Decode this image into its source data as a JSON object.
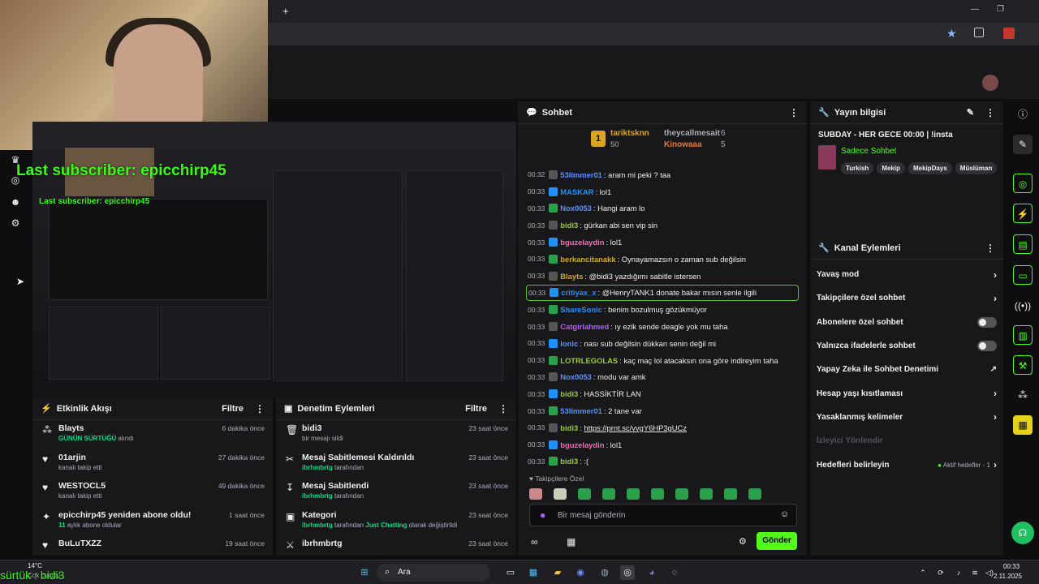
{
  "browser": {
    "new_tab": "+",
    "minimize": "—",
    "restore": "❐"
  },
  "overlay": {
    "last_subscriber": "Last subscriber: epicchirp45",
    "last_subscriber_small": "Last subscriber: epicchirp45",
    "bottom_text": "sürtük : bidi3"
  },
  "activity_feed": {
    "title": "Etkinlik Akışı",
    "filter": "Filtre",
    "items": [
      {
        "name": "Blayts",
        "detail_highlight": "GÜNÜN SÜRTÜĞÜ",
        "detail": " alındı",
        "time": "6 dakika önce",
        "icon": "points-icon"
      },
      {
        "name": "01arjin",
        "detail_highlight": "",
        "detail": "kanalı takip etti",
        "time": "27 dakika önce",
        "icon": "heart-icon"
      },
      {
        "name": "WESTOCL5",
        "detail_highlight": "",
        "detail": "kanalı takip etti",
        "time": "49 dakika önce",
        "icon": "heart-icon"
      },
      {
        "name": "epicchirp45 yeniden abone oldu!",
        "detail_highlight": "11",
        "detail": " aylık abone oldular",
        "time": "1 saat önce",
        "icon": "star-icon"
      },
      {
        "name": "BuLuTXZZ",
        "detail_highlight": "",
        "detail": "",
        "time": "19 saat önce",
        "icon": "heart-icon"
      }
    ]
  },
  "mod_actions": {
    "title": "Denetim Eylemleri",
    "filter": "Filtre",
    "items": [
      {
        "name": "bidi3",
        "detail_highlight": "",
        "detail": "bir mesajı sildi",
        "detail2": "",
        "detail3": "",
        "time": "23 saat önce",
        "icon": "trash-icon"
      },
      {
        "name": "Mesaj Sabitlemesi Kaldırıldı",
        "detail_highlight": "ibrhmbrtg",
        "detail": " tarafından",
        "detail2": "",
        "detail3": "",
        "time": "23 saat önce",
        "icon": "unpin-icon"
      },
      {
        "name": "Mesaj Sabitlendi",
        "detail_highlight": "ibrhmbrtg",
        "detail": " tarafından",
        "detail2": "",
        "detail3": "",
        "time": "23 saat önce",
        "icon": "pin-icon"
      },
      {
        "name": "Kategori",
        "detail_highlight": "ibrhmbrtg",
        "detail": " tarafından ",
        "detail2": "Just Chatting",
        "detail3": " olarak değiştirildi",
        "time": "23 saat önce",
        "icon": "category-icon"
      },
      {
        "name": "ibrhmbrtg",
        "detail_highlight": "",
        "detail": "",
        "detail2": "",
        "detail3": "",
        "time": "23 saat önce",
        "icon": "mod-icon"
      }
    ]
  },
  "chat": {
    "title": "Sohbet",
    "leaderboard": {
      "first_name": "tariktsknn",
      "first_points": "50",
      "second_name": "theycallmesait",
      "second_count": "6",
      "third_name": "Kinowaaa",
      "third_count": "5"
    },
    "messages": [
      {
        "time": "00:32",
        "user": "53limmer01",
        "color": "#5c8fff",
        "text": "aram mi peki ? taa"
      },
      {
        "time": "00:33",
        "user": "MASKAR",
        "color": "#1e90ff",
        "text": "lol1"
      },
      {
        "time": "00:33",
        "user": "Nox0053",
        "color": "#5c8fff",
        "text": "Hangi aram lo"
      },
      {
        "time": "00:33",
        "user": "bidi3",
        "color": "#9acd32",
        "text": "gürkan abi sen vip sin"
      },
      {
        "time": "00:33",
        "user": "bguzelaydin",
        "color": "#ff69b4",
        "text": "lol1"
      },
      {
        "time": "00:33",
        "user": "berkancitanakk",
        "color": "#daa520",
        "text": "Oynayamazsın o zaman sub değilsin"
      },
      {
        "time": "00:33",
        "user": "Blayts",
        "color": "#daa520",
        "text": "@bidi3 yazdığımı sabitle istersen"
      },
      {
        "time": "00:33",
        "user": "critiyax_x",
        "color": "#1e90ff",
        "text": "@HenryTANK1 donate bakar mısın senle ilgili"
      },
      {
        "time": "00:33",
        "user": "ShareSonic",
        "color": "#1e90ff",
        "text": "benim bozulmuş gözükmüyor"
      },
      {
        "time": "00:33",
        "user": "Catgirlahmed",
        "color": "#b85cff",
        "text": "ıy ezik sende deagle yok mu taha"
      },
      {
        "time": "00:33",
        "user": "lonic",
        "color": "#5c8fff",
        "text": "nası sub değilsin dükkan senin değil mi"
      },
      {
        "time": "00:33",
        "user": "LOTRLEGOLAS",
        "color": "#9acd32",
        "text": "kaç maç lol atacaksın ona göre indireyim taha"
      },
      {
        "time": "00:33",
        "user": "Nox0053",
        "color": "#5c8fff",
        "text": "modu var amk"
      },
      {
        "time": "00:33",
        "user": "bidi3",
        "color": "#9acd32",
        "text": "HASSİKTİR LAN"
      },
      {
        "time": "00:33",
        "user": "53limmer01",
        "color": "#5c8fff",
        "text": "2 tane var"
      },
      {
        "time": "00:33",
        "user": "bidi3",
        "color": "#9acd32",
        "text": "https://prnt.sc/vvgY6HP3gUCz"
      },
      {
        "time": "00:33",
        "user": "bguzelaydin",
        "color": "#ff69b4",
        "text": "lol1"
      },
      {
        "time": "00:33",
        "user": "bidi3",
        "color": "#9acd32",
        "text": ":("
      }
    ],
    "followers_only": "Takipçilere Özel",
    "input_placeholder": "Bir mesaj gönderin",
    "send": "Gönder"
  },
  "stream_info": {
    "title": "Yayın bilgisi",
    "stream_title": "SUBDAY - HER GECE 00:00 | !insta",
    "category": "Sadece Sohbet",
    "tags": [
      "Turkish",
      "Mekip",
      "MekipDays",
      "Müslüman"
    ]
  },
  "channel_actions": {
    "title": "Kanal Eylemleri",
    "items": [
      {
        "label": "Yavaş mod",
        "control": "chevron"
      },
      {
        "label": "Takipçilere özel sohbet",
        "control": "chevron"
      },
      {
        "label": "Abonelere özel sohbet",
        "control": "toggle"
      },
      {
        "label": "Yalnızca ifadelerle sohbet",
        "control": "toggle"
      },
      {
        "label": "Yapay Zeka ile Sohbet Denetimi",
        "control": "external"
      },
      {
        "label": "Hesap yaşı kısıtlaması",
        "control": "chevron"
      },
      {
        "label": "Yasaklanmış kelimeler",
        "control": "chevron"
      },
      {
        "label": "İzleyici Yönlendir",
        "control": "none"
      },
      {
        "label": "Hedefleri belirleyin",
        "control": "chevron"
      }
    ],
    "goals_status": "Aktif hedefler - 1"
  },
  "taskbar": {
    "weather_temp": "14°C",
    "weather_text": "Çok bulutlu",
    "search": "Ara",
    "time": "00:33",
    "date": "2.11.2025"
  },
  "colors": {
    "accent": "#53fc18",
    "bg": "#0e0e10",
    "panel": "#18181b"
  }
}
